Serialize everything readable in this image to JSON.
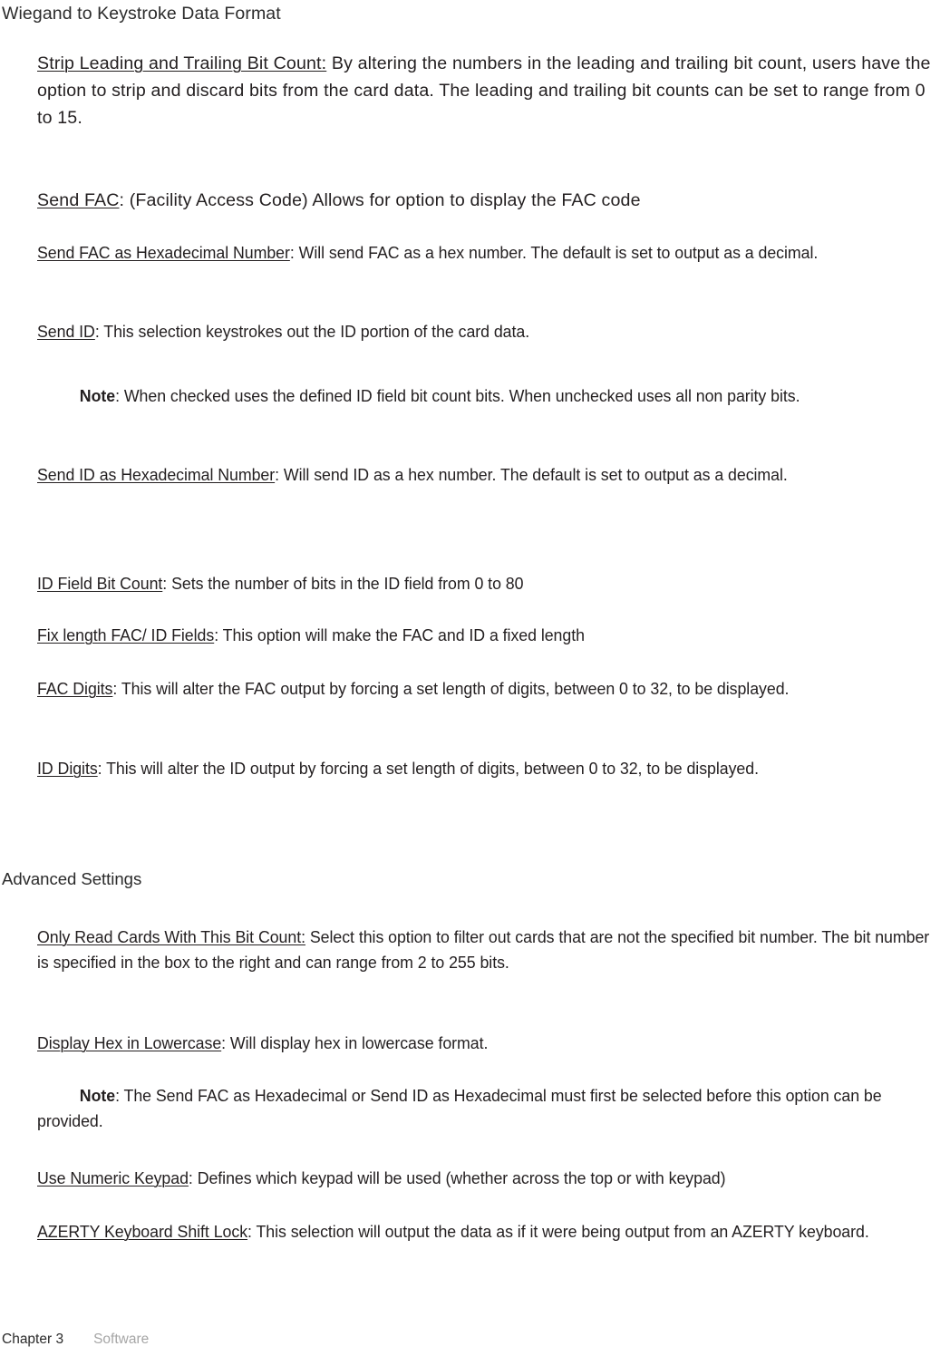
{
  "document": {
    "heading": "Wiegand to Keystroke Data Format",
    "sections": [
      {
        "id": "strip-leading-trailing",
        "term": "Strip Leading and Trailing Bit Count:",
        "description": " By altering the numbers in the leading and trailing bit count, users have the option to strip and discard bits from the card data. The leading and trailing bit counts can be set to range from 0 to 15."
      },
      {
        "id": "send-fac",
        "term": "Send FAC",
        "description": ": (Facility Access Code) Allows for option to display the FAC code"
      },
      {
        "id": "send-fac-hex",
        "term": "Send FAC as Hexadecimal Number",
        "description": ": Will send FAC as a hex number. The default is set to output as a decimal."
      },
      {
        "id": "send-id",
        "term": "Send ID",
        "description": ": This selection keystrokes out the ID portion of the card data."
      },
      {
        "id": "send-id-hex",
        "term": "Send ID as Hexadecimal Number",
        "description": ": Will send ID as a hex number. The default is set to output as a decimal."
      },
      {
        "id": "id-field-bit-count",
        "term": "ID Field Bit Count",
        "description": ": Sets the number of bits in the ID field from 0 to 80"
      },
      {
        "id": "fix-length-fac-id",
        "term": "Fix length FAC/ ID Fields",
        "description": ": This option will make the FAC and ID a fixed length"
      },
      {
        "id": "fac-digits",
        "term": "FAC Digits",
        "description": ": This will alter the FAC output by forcing a set length of digits, between 0 to 32, to be displayed."
      },
      {
        "id": "id-digits",
        "term": "ID Digits",
        "description": ": This will alter the ID output by forcing a set length of digits, between 0 to 32, to be displayed."
      },
      {
        "id": "only-read-cards",
        "term": "Only Read Cards With This Bit Count:",
        "description": " Select this option to filter out cards that are not the specified bit number. The bit number is specified in the box to the right and can range from 2 to 255 bits."
      },
      {
        "id": "display-hex-lowercase",
        "term": "Display Hex in Lowercase",
        "description": ": Will display hex in lowercase format."
      },
      {
        "id": "use-numeric-keypad",
        "term": "Use Numeric Keypad",
        "description": ": Defines which keypad will be used (whether across the top or with keypad)"
      },
      {
        "id": "azerty-shift-lock",
        "term": "AZERTY Keyboard Shift Lock",
        "description": ": This selection will output the data as if it were being output from an AZERTY keyboard."
      }
    ],
    "notes": [
      {
        "id": "note-send-id",
        "label": "Note",
        "text": ":  When checked uses the defined ID field bit count bits. When unchecked uses all non parity bits."
      },
      {
        "id": "note-display-hex",
        "label": "Note",
        "text": ": The Send FAC as Hexadecimal or Send ID as Hexadecimal must first be selected before this option can be provided."
      }
    ],
    "advanced_settings_heading": "Advanced Settings"
  },
  "footer": {
    "chapter": "Chapter 3",
    "section_name": "Software"
  }
}
